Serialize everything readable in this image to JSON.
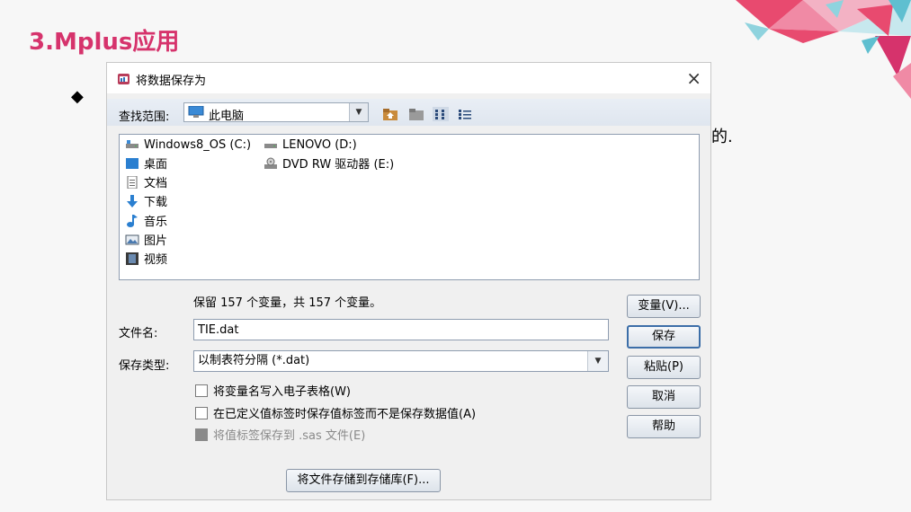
{
  "slide": {
    "title": "3.Mplus应用",
    "bullet": "◆",
    "trailing_text": "的."
  },
  "dialog": {
    "title": "将数据保存为",
    "close": "×",
    "look_in_label": "查找范围:",
    "look_in_value": "此电脑",
    "locations": [
      {
        "label": "Windows8_OS (C:)",
        "icon": "drive-icon"
      },
      {
        "label": "桌面",
        "icon": "desktop-icon"
      },
      {
        "label": "文档",
        "icon": "documents-icon"
      },
      {
        "label": "下载",
        "icon": "downloads-icon"
      },
      {
        "label": "音乐",
        "icon": "music-icon"
      },
      {
        "label": "图片",
        "icon": "pictures-icon"
      },
      {
        "label": "视频",
        "icon": "videos-icon"
      },
      {
        "label": "LENOVO (D:)",
        "icon": "drive-icon"
      },
      {
        "label": "DVD RW 驱动器 (E:)",
        "icon": "dvd-drive-icon"
      }
    ],
    "info": "保留 157 个变量，共 157 个变量。",
    "filename_label": "文件名:",
    "filename_value": "TIE.dat",
    "filetype_label": "保存类型:",
    "filetype_value": "以制表符分隔 (*.dat)",
    "checkboxes": [
      {
        "label": "将变量名写入电子表格(W)",
        "checked": false,
        "enabled": true
      },
      {
        "label": "在已定义值标签时保存值标签而不是保存数据值(A)",
        "checked": false,
        "enabled": true
      },
      {
        "label": "将值标签保存到 .sas 文件(E)",
        "checked": false,
        "enabled": false
      }
    ],
    "buttons": {
      "variables": "变量(V)...",
      "save": "保存",
      "paste": "粘贴(P)",
      "cancel": "取消",
      "help": "帮助",
      "store_repository": "将文件存储到存储库(F)..."
    }
  }
}
